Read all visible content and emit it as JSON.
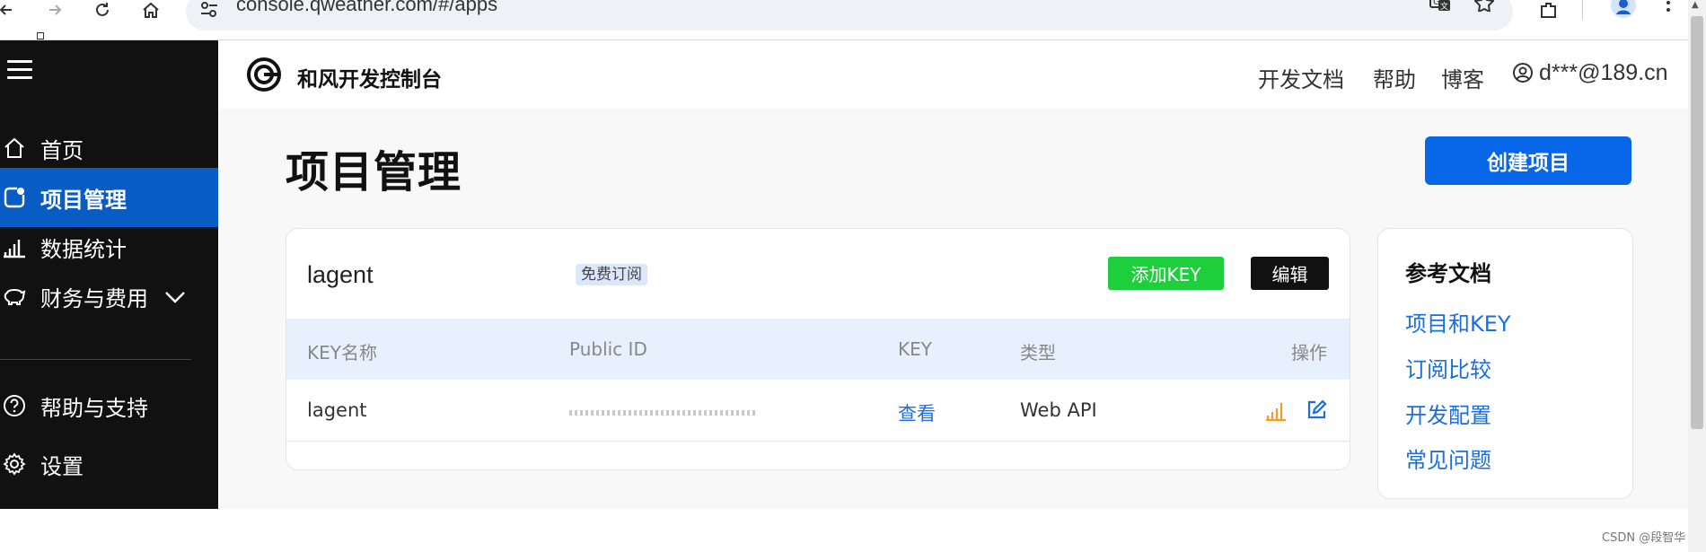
{
  "browser": {
    "url": "console.qweather.com/#/apps"
  },
  "sidebar": {
    "items": [
      {
        "label": "首页",
        "icon": "home-icon"
      },
      {
        "label": "项目管理",
        "icon": "project-icon",
        "active": true
      },
      {
        "label": "数据统计",
        "icon": "bar-chart-icon"
      },
      {
        "label": "财务与费用",
        "icon": "piggy-bank-icon",
        "expandable": true
      },
      {
        "label": "帮助与支持",
        "icon": "help-icon"
      },
      {
        "label": "设置",
        "icon": "gear-icon"
      }
    ]
  },
  "header": {
    "brand": "和风开发控制台",
    "links": [
      "开发文档",
      "帮助",
      "博客"
    ],
    "user_email": "d***@189.cn"
  },
  "page": {
    "title": "项目管理",
    "create_button": "创建项目"
  },
  "project": {
    "name": "lagent",
    "badge": "免费订阅",
    "add_key_button": "添加KEY",
    "edit_button": "编辑",
    "columns": [
      "KEY名称",
      "Public ID",
      "KEY",
      "类型",
      "操作"
    ],
    "rows": [
      {
        "key_name": "lagent",
        "key_link": "查看",
        "type": "Web API"
      }
    ]
  },
  "reference": {
    "title": "参考文档",
    "links": [
      "项目和KEY",
      "订阅比较",
      "开发配置",
      "常见问题"
    ]
  },
  "watermark": "CSDN @段智华",
  "colors": {
    "sidebar_bg": "#111111",
    "sidebar_active": "#0a5cc5",
    "primary": "#0866e8",
    "add_key_green": "#1fce3d",
    "link_blue": "#1a6ee0",
    "table_header_bg": "#e7f0fd"
  }
}
